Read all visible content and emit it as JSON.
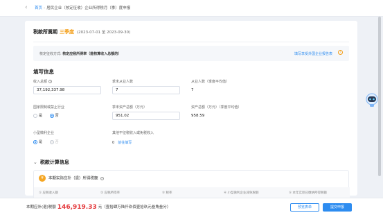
{
  "header": {
    "back_icon": "chevron-left-icon",
    "breadcrumb": [
      "首页",
      "居民企业（核定征收）企业所得税月（季）度申报"
    ]
  },
  "period": {
    "label": "税款所属期",
    "quarter": "三季度",
    "range": "(2023-07-01 至 2023-09-30)"
  },
  "method": {
    "label": "核定征收方式:",
    "value": "核定应税所得率（能核算收入总额的）",
    "link": "填写享受外国企业报告表",
    "info_icon": "info-icon"
  },
  "fill_section": {
    "title": "填写信息",
    "fields": {
      "income_total": {
        "label": "收入总额",
        "value": "37,192,337.98"
      },
      "employees_q_end": {
        "label": "季末从业人数",
        "value": "7"
      },
      "employees_avg": {
        "label": "从业人数（季度平均值）",
        "value": "7"
      },
      "restricted_industry": {
        "label": "国家限制或禁止行业",
        "options": [
          "是",
          "否"
        ],
        "selected": "否"
      },
      "assets_q_end": {
        "label": "季末资产总额（万元）",
        "value": "951.02"
      },
      "assets_avg": {
        "label": "资产总额（万元）（季度平均值）",
        "value": "958.59"
      },
      "small_micro": {
        "label": "小型微利企业",
        "options": [
          "是",
          "否"
        ],
        "selected": "是"
      },
      "other_deductions": {
        "label": "其他不征税收入或免税收入",
        "value": "0",
        "link": "前往填写"
      }
    }
  },
  "calc_section": {
    "title": "税款计算信息",
    "sub_title": "本期实际应补（退）所得税额",
    "coin_icon": "currency-yen-icon",
    "columns": [
      "① 应税收入额",
      "② 应税所得率",
      "③ 税率",
      "④ 小型微利企业减免税额",
      "⑤ 本年实际已缴纳所得税额"
    ]
  },
  "footer": {
    "prefix": "本期应补(退)税额",
    "amount": "146,919.33",
    "suffix": "元（壹拾肆万陆仟玖佰壹拾玖元叁角叁分）",
    "preview_button": "预览表单",
    "submit_button": "提交申报"
  },
  "colors": {
    "primary": "#2d8cf0",
    "accent": "#f39c12",
    "amount": "#e4393c"
  }
}
